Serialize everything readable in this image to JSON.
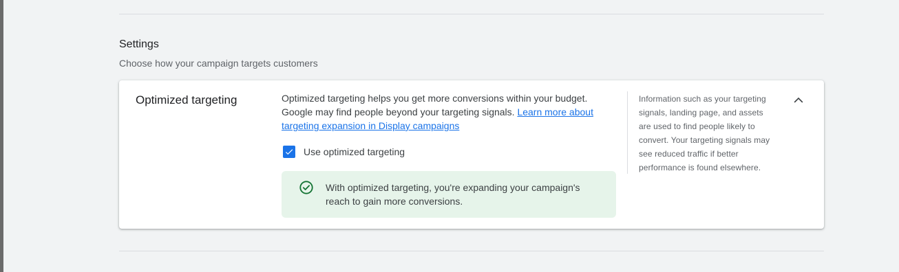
{
  "settings": {
    "title": "Settings",
    "subtitle": "Choose how your campaign targets customers"
  },
  "card": {
    "title": "Optimized targeting",
    "description": "Optimized targeting helps you get more conversions within your budget. Google may find people beyond your targeting signals.",
    "learn_more_link": "Learn more about targeting expansion in Display campaigns",
    "checkbox": {
      "label": "Use optimized targeting",
      "checked": true
    },
    "notice": {
      "text": "With optimized targeting, you're expanding your campaign's reach to gain more conversions.",
      "icon": "check-circle-icon"
    },
    "info_text": "Information such as your targeting signals, landing page, and assets are used to find people likely to convert. Your targeting signals may see reduced traffic if better performance is found elsewhere.",
    "collapse_icon": "chevron-up-icon"
  },
  "colors": {
    "accent": "#1a73e8",
    "success": "#137333",
    "success_bg": "#e6f4ea"
  }
}
